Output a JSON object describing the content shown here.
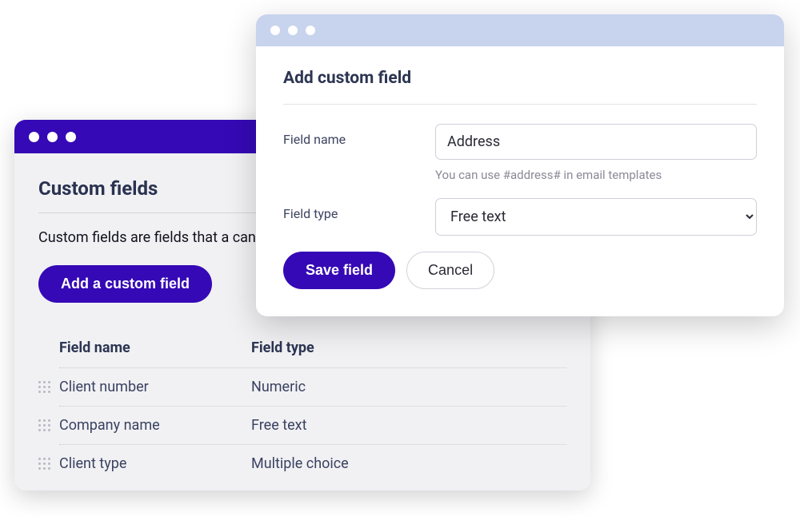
{
  "list_window": {
    "title": "Custom fields",
    "description": "Custom fields are fields that a can segment.",
    "add_button": "Add a custom field",
    "columns": {
      "name": "Field name",
      "type": "Field type"
    },
    "rows": [
      {
        "name": "Client number",
        "type": "Numeric"
      },
      {
        "name": "Company name",
        "type": "Free text"
      },
      {
        "name": "Client type",
        "type": "Multiple choice"
      }
    ]
  },
  "dialog": {
    "title": "Add custom field",
    "field_name_label": "Field name",
    "field_name_value": "Address",
    "field_name_hint": "You can use #address# in email templates",
    "field_type_label": "Field type",
    "field_type_value": "Free text",
    "save_label": "Save field",
    "cancel_label": "Cancel"
  },
  "colors": {
    "brand": "#3509b5",
    "dialog_titlebar": "#c8d3ed"
  }
}
